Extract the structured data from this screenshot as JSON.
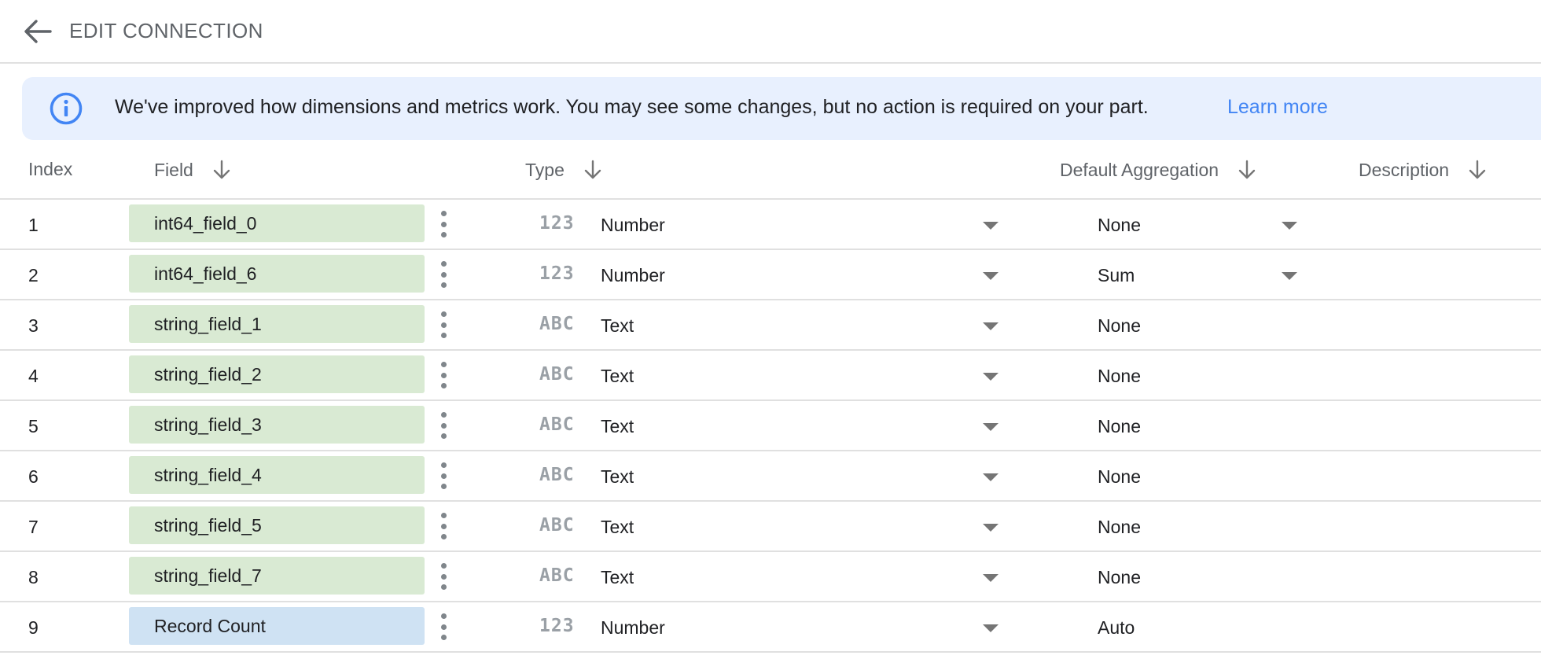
{
  "header": {
    "title": "EDIT CONNECTION",
    "back_icon": "arrow-left-icon"
  },
  "banner": {
    "icon": "info-icon",
    "message": "We've improved how dimensions and metrics work. You may see some changes, but no action is required on your part.",
    "link": "Learn more",
    "accent": "#4285f4",
    "background": "#e8f0fe"
  },
  "columns": {
    "index": "Index",
    "field": "Field",
    "type": "Type",
    "aggregation": "Default Aggregation",
    "description": "Description"
  },
  "colors": {
    "dimension": "#d9ead3",
    "metric": "#cfe2f3"
  },
  "rows": [
    {
      "index": "1",
      "field": "int64_field_0",
      "kind": "dimension",
      "type_icon": "123",
      "type": "Number",
      "aggregation": "None",
      "aggregation_editable": true,
      "description": ""
    },
    {
      "index": "2",
      "field": "int64_field_6",
      "kind": "dimension",
      "type_icon": "123",
      "type": "Number",
      "aggregation": "Sum",
      "aggregation_editable": true,
      "description": ""
    },
    {
      "index": "3",
      "field": "string_field_1",
      "kind": "dimension",
      "type_icon": "ABC",
      "type": "Text",
      "aggregation": "None",
      "aggregation_editable": false,
      "description": ""
    },
    {
      "index": "4",
      "field": "string_field_2",
      "kind": "dimension",
      "type_icon": "ABC",
      "type": "Text",
      "aggregation": "None",
      "aggregation_editable": false,
      "description": ""
    },
    {
      "index": "5",
      "field": "string_field_3",
      "kind": "dimension",
      "type_icon": "ABC",
      "type": "Text",
      "aggregation": "None",
      "aggregation_editable": false,
      "description": ""
    },
    {
      "index": "6",
      "field": "string_field_4",
      "kind": "dimension",
      "type_icon": "ABC",
      "type": "Text",
      "aggregation": "None",
      "aggregation_editable": false,
      "description": ""
    },
    {
      "index": "7",
      "field": "string_field_5",
      "kind": "dimension",
      "type_icon": "ABC",
      "type": "Text",
      "aggregation": "None",
      "aggregation_editable": false,
      "description": ""
    },
    {
      "index": "8",
      "field": "string_field_7",
      "kind": "dimension",
      "type_icon": "ABC",
      "type": "Text",
      "aggregation": "None",
      "aggregation_editable": false,
      "description": ""
    },
    {
      "index": "9",
      "field": "Record Count",
      "kind": "metric",
      "type_icon": "123",
      "type": "Number",
      "aggregation": "Auto",
      "aggregation_editable": false,
      "description": ""
    }
  ]
}
